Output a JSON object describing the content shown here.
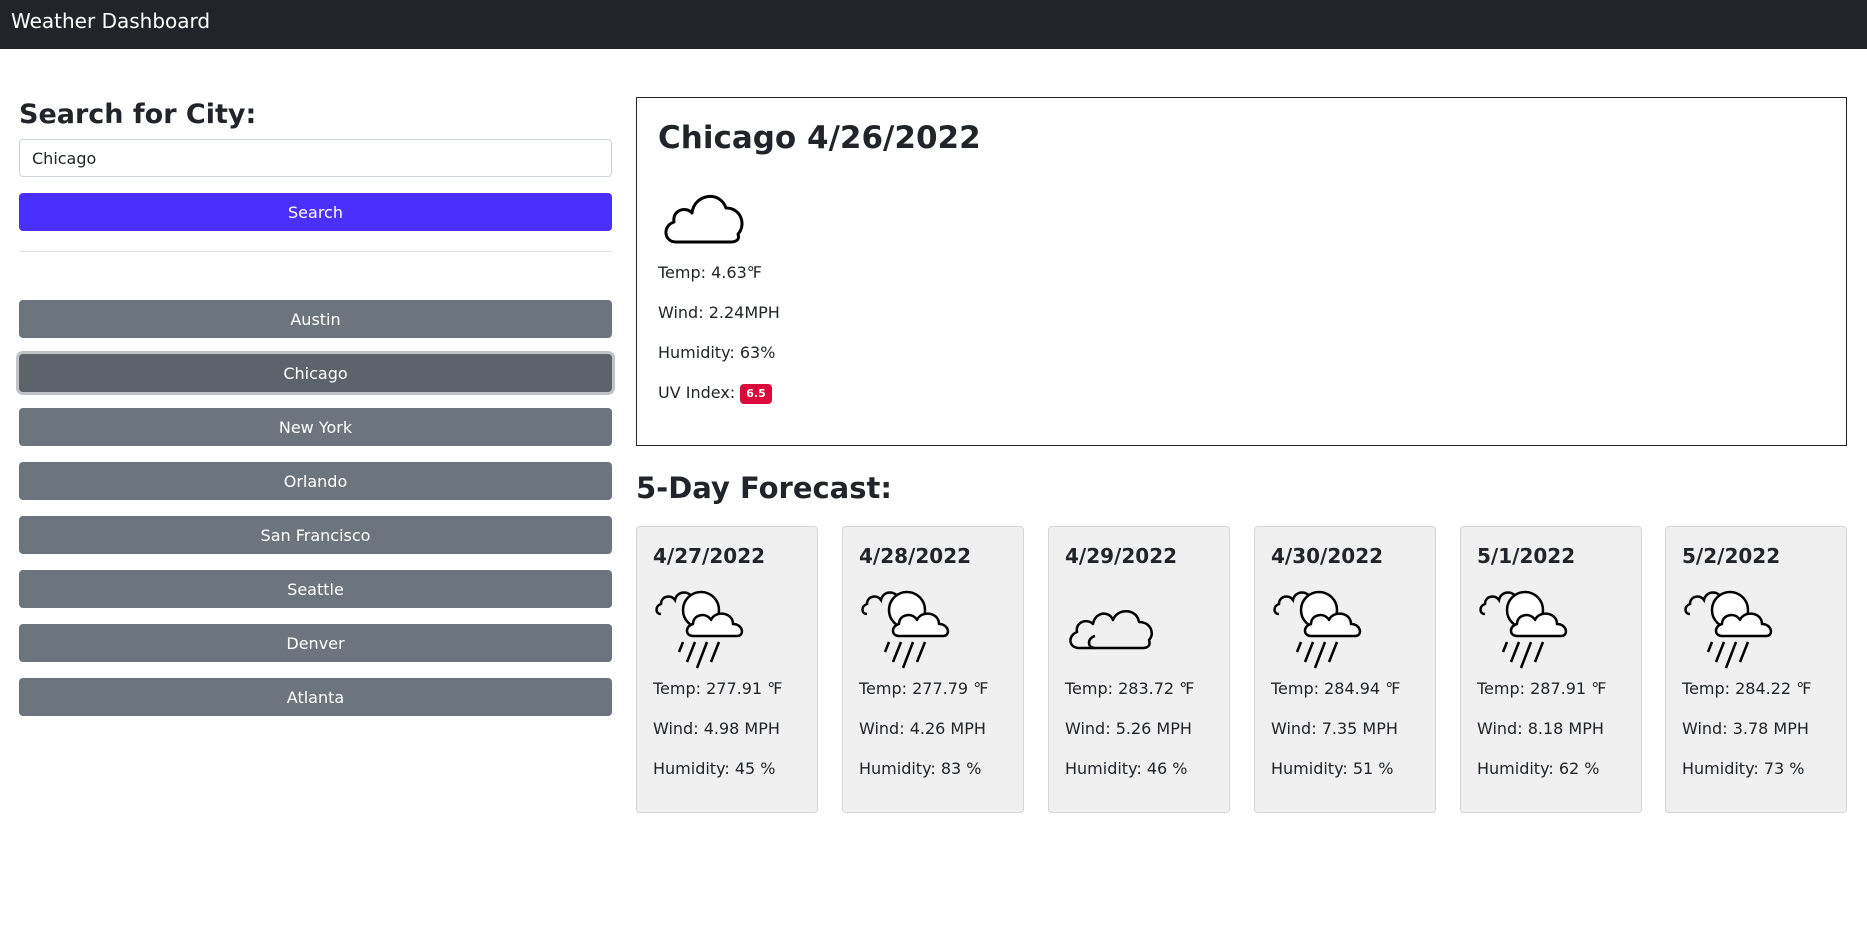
{
  "app": {
    "title": "Weather Dashboard"
  },
  "search": {
    "heading": "Search for City:",
    "value": "Chicago",
    "button_label": "Search"
  },
  "history": {
    "active": "Chicago",
    "items": [
      {
        "label": "Austin"
      },
      {
        "label": "Chicago"
      },
      {
        "label": "New York"
      },
      {
        "label": "Orlando"
      },
      {
        "label": "San Francisco"
      },
      {
        "label": "Seattle"
      },
      {
        "label": "Denver"
      },
      {
        "label": "Atlanta"
      }
    ]
  },
  "current": {
    "heading": "Chicago 4/26/2022",
    "icon": "cloud-icon",
    "temp": "Temp: 4.63℉",
    "wind": "Wind: 2.24MPH",
    "humidity": "Humidity: 63%",
    "uv_label": "UV Index:",
    "uv_value": "6.5",
    "uv_color": "#dc0a3c"
  },
  "forecast": {
    "heading": "5-Day Forecast:",
    "days": [
      {
        "date": "4/27/2022",
        "icon": "rain-icon",
        "temp": "Temp: 277.91 ℉",
        "wind": "Wind: 4.98 MPH",
        "humidity": "Humidity: 45 %"
      },
      {
        "date": "4/28/2022",
        "icon": "rain-icon",
        "temp": "Temp: 277.79 ℉",
        "wind": "Wind: 4.26 MPH",
        "humidity": "Humidity: 83 %"
      },
      {
        "date": "4/29/2022",
        "icon": "cloud-icon",
        "temp": "Temp: 283.72 ℉",
        "wind": "Wind: 5.26 MPH",
        "humidity": "Humidity: 46 %"
      },
      {
        "date": "4/30/2022",
        "icon": "rain-icon",
        "temp": "Temp: 284.94 ℉",
        "wind": "Wind: 7.35 MPH",
        "humidity": "Humidity: 51 %"
      },
      {
        "date": "5/1/2022",
        "icon": "rain-icon",
        "temp": "Temp: 287.91 ℉",
        "wind": "Wind: 8.18 MPH",
        "humidity": "Humidity: 62 %"
      },
      {
        "date": "5/2/2022",
        "icon": "rain-icon",
        "temp": "Temp: 284.22 ℉",
        "wind": "Wind: 3.78 MPH",
        "humidity": "Humidity: 73 %"
      }
    ]
  },
  "colors": {
    "navbar": "#212529",
    "search_button": "#4a2ffd",
    "history_button": "#6c757d",
    "history_button_active": "#5c636a",
    "card_bg": "#f0f0f0"
  }
}
